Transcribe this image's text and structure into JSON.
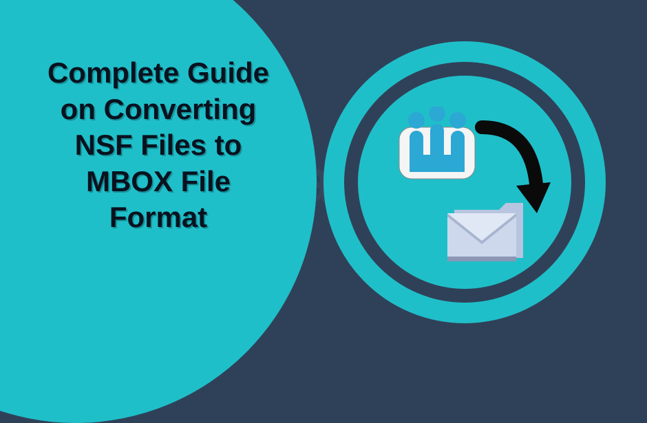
{
  "colors": {
    "background": "#2f4158",
    "accent": "#1fbfc9",
    "text": "#08121f"
  },
  "heading": {
    "text": "Complete Guide on Converting NSF Files to MBOX File Format"
  },
  "watermark": {
    "text": "Data"
  },
  "icons": {
    "source": "lotus-notes-icon",
    "target": "mbox-folder-icon",
    "arrow": "curved-arrow-icon"
  }
}
